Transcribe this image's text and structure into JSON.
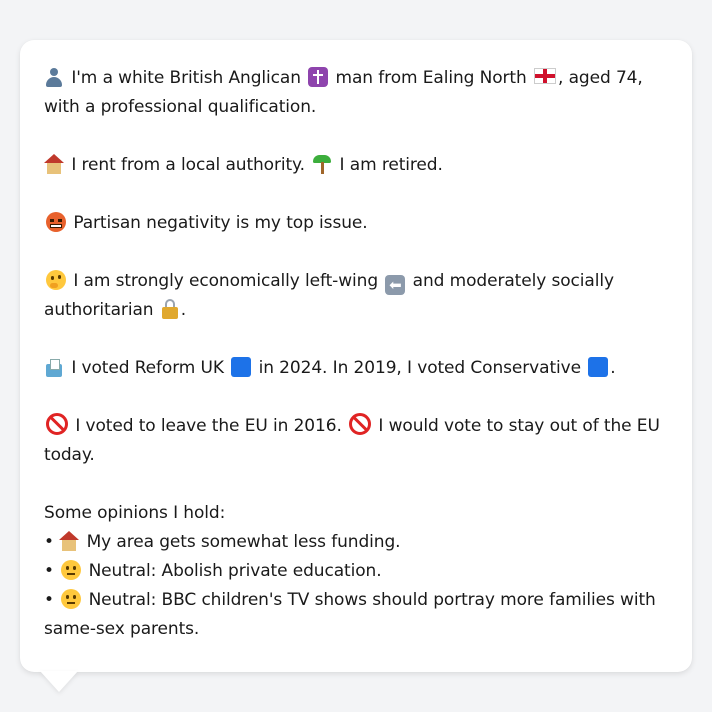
{
  "profile": {
    "intro_a": "I'm a white British Anglican",
    "intro_b": "man from Ealing North",
    "intro_c": ", aged 74, with a professional qualification.",
    "housing_a": "I rent from a local authority.",
    "housing_b": "I am retired.",
    "issue": "Partisan negativity is my top issue.",
    "ideology_a": "I am strongly economically left-wing",
    "ideology_b": "and moderately socially authoritarian",
    "ideology_c": ".",
    "vote_a": "I voted Reform UK",
    "vote_b": "in 2024. In 2019, I voted Conservative",
    "vote_c": ".",
    "eu_a": "I voted to leave the EU in 2016.",
    "eu_b": "I would vote to stay out of the EU today.",
    "opinions_heading": "Some opinions I hold:",
    "opinions": [
      "My area gets somewhat less funding.",
      "Neutral: Abolish private education.",
      "Neutral: BBC children's TV shows should portray more families with same-sex parents."
    ],
    "bullet": "•"
  },
  "icons": {
    "person": "person-silhouette-icon",
    "religion": "latin-cross-icon",
    "flag": "england-flag-icon",
    "house": "house-icon",
    "palm": "palm-tree-icon",
    "angry": "cursing-face-icon",
    "thinking": "thinking-face-icon",
    "left_arrow": "left-arrow-icon",
    "lock": "lock-icon",
    "ballot": "ballot-box-icon",
    "party_square": "blue-square-icon",
    "no_entry": "prohibited-icon",
    "neutral": "neutral-face-icon"
  },
  "colors": {
    "background": "#f3f4f6",
    "card": "#ffffff",
    "text": "#1a1a1a",
    "party_blue": "#1d72e8",
    "prohibit_red": "#e02424"
  }
}
